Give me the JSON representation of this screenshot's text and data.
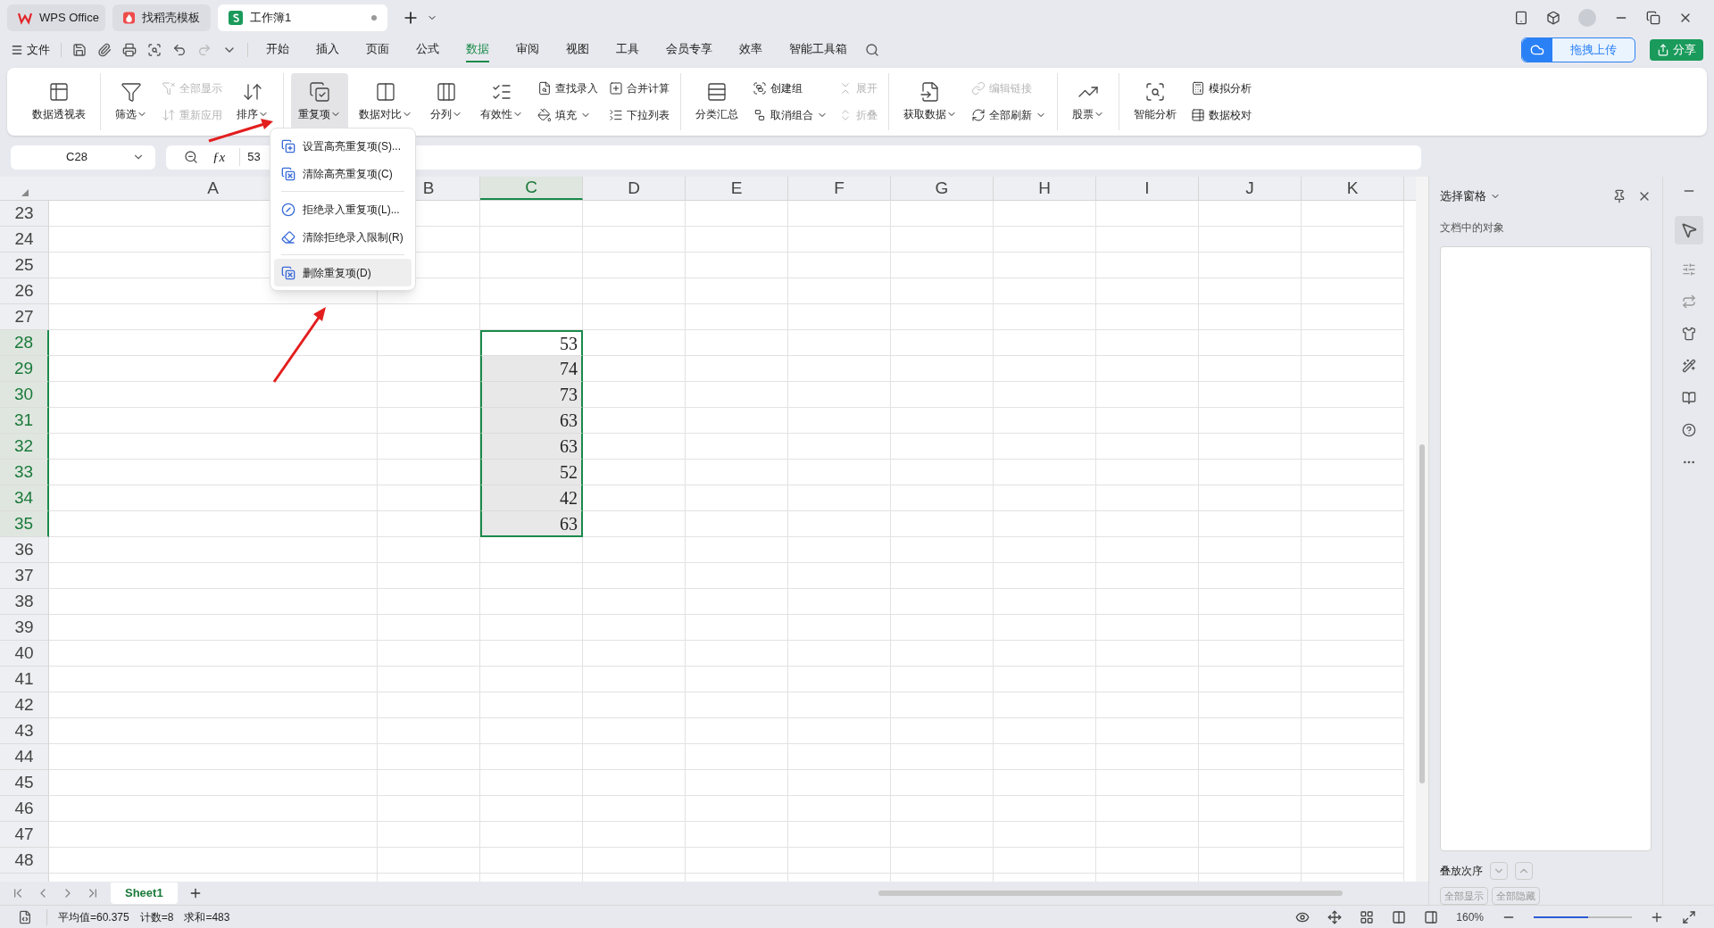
{
  "app_tabs": [
    {
      "label": "WPS Office",
      "kind": "home",
      "selected": false
    },
    {
      "label": "找稻壳模板",
      "kind": "template",
      "selected": false
    },
    {
      "label": "工作簿1",
      "kind": "sheet",
      "selected": true
    }
  ],
  "menu": {
    "file": "文件",
    "tabs": [
      {
        "label": "开始",
        "selected": false
      },
      {
        "label": "插入",
        "selected": false
      },
      {
        "label": "页面",
        "selected": false
      },
      {
        "label": "公式",
        "selected": false
      },
      {
        "label": "数据",
        "selected": true
      },
      {
        "label": "审阅",
        "selected": false
      },
      {
        "label": "视图",
        "selected": false
      },
      {
        "label": "工具",
        "selected": false
      },
      {
        "label": "会员专享",
        "selected": false
      },
      {
        "label": "效率",
        "selected": false
      },
      {
        "label": "智能工具箱",
        "selected": false
      }
    ],
    "upload": "拖拽上传",
    "share": "分享"
  },
  "ribbon": [
    {
      "items": [
        {
          "kind": "large",
          "label": "数据透视表",
          "dropdown": false,
          "pressed": false
        }
      ]
    },
    {
      "items": [
        {
          "kind": "large",
          "label": "筛选",
          "dropdown": true,
          "pressed": false
        },
        {
          "kind": "stack",
          "items": [
            {
              "label": "全部显示",
              "disabled": true,
              "dropdown": false
            },
            {
              "label": "重新应用",
              "disabled": true,
              "dropdown": false
            }
          ]
        },
        {
          "kind": "large",
          "label": "排序",
          "dropdown": true,
          "pressed": false
        }
      ]
    },
    {
      "items": [
        {
          "kind": "large",
          "label": "重复项",
          "dropdown": true,
          "pressed": true
        },
        {
          "kind": "large",
          "label": "数据对比",
          "dropdown": true,
          "pressed": false
        },
        {
          "kind": "large",
          "label": "分列",
          "dropdown": true,
          "pressed": false
        },
        {
          "kind": "large",
          "label": "有效性",
          "dropdown": true,
          "pressed": false
        },
        {
          "kind": "stack",
          "items": [
            {
              "label": "查找录入",
              "disabled": false,
              "dropdown": false
            },
            {
              "label": "填充",
              "disabled": false,
              "dropdown": true
            }
          ]
        },
        {
          "kind": "stack",
          "items": [
            {
              "label": "合并计算",
              "disabled": false,
              "dropdown": false
            },
            {
              "label": "下拉列表",
              "disabled": false,
              "dropdown": false
            }
          ]
        }
      ]
    },
    {
      "items": [
        {
          "kind": "large",
          "label": "分类汇总",
          "dropdown": false,
          "pressed": false
        },
        {
          "kind": "stack",
          "items": [
            {
              "label": "创建组",
              "disabled": false,
              "dropdown": false
            },
            {
              "label": "取消组合",
              "disabled": false,
              "dropdown": true
            }
          ]
        },
        {
          "kind": "stack",
          "items": [
            {
              "label": "展开",
              "disabled": true,
              "dropdown": false
            },
            {
              "label": "折叠",
              "disabled": true,
              "dropdown": false
            }
          ]
        }
      ]
    },
    {
      "items": [
        {
          "kind": "large",
          "label": "获取数据",
          "dropdown": true,
          "pressed": false
        },
        {
          "kind": "stack",
          "items": [
            {
              "label": "编辑链接",
              "disabled": true,
              "dropdown": false
            },
            {
              "label": "全部刷新",
              "disabled": false,
              "dropdown": true
            }
          ]
        }
      ]
    },
    {
      "items": [
        {
          "kind": "large",
          "label": "股票",
          "dropdown": true,
          "pressed": false
        }
      ]
    },
    {
      "items": [
        {
          "kind": "large",
          "label": "智能分析",
          "dropdown": false,
          "pressed": false
        },
        {
          "kind": "stack",
          "items": [
            {
              "label": "模拟分析",
              "disabled": false,
              "dropdown": false
            },
            {
              "label": "数据校对",
              "disabled": false,
              "dropdown": false
            }
          ]
        }
      ]
    }
  ],
  "name_box": "C28",
  "function_label": "ƒx",
  "formula": "53",
  "columns": [
    {
      "label": "A",
      "selected": false
    },
    {
      "label": "B",
      "selected": false
    },
    {
      "label": "C",
      "selected": true
    },
    {
      "label": "D",
      "selected": false
    },
    {
      "label": "E",
      "selected": false
    },
    {
      "label": "F",
      "selected": false
    },
    {
      "label": "G",
      "selected": false
    },
    {
      "label": "H",
      "selected": false
    },
    {
      "label": "I",
      "selected": false
    },
    {
      "label": "J",
      "selected": false
    },
    {
      "label": "K",
      "selected": false
    }
  ],
  "rows": [
    {
      "label": "23",
      "selected": false
    },
    {
      "label": "24",
      "selected": false
    },
    {
      "label": "25",
      "selected": false
    },
    {
      "label": "26",
      "selected": false
    },
    {
      "label": "27",
      "selected": false
    },
    {
      "label": "28",
      "selected": true,
      "active": true,
      "value": "53"
    },
    {
      "label": "29",
      "selected": true,
      "active": false,
      "value": "74"
    },
    {
      "label": "30",
      "selected": true,
      "active": false,
      "value": "73"
    },
    {
      "label": "31",
      "selected": true,
      "active": false,
      "value": "63"
    },
    {
      "label": "32",
      "selected": true,
      "active": false,
      "value": "63"
    },
    {
      "label": "33",
      "selected": true,
      "active": false,
      "value": "52"
    },
    {
      "label": "34",
      "selected": true,
      "active": false,
      "value": "42"
    },
    {
      "label": "35",
      "selected": true,
      "active": false,
      "value": "63"
    },
    {
      "label": "36",
      "selected": false
    },
    {
      "label": "37",
      "selected": false
    },
    {
      "label": "38",
      "selected": false
    },
    {
      "label": "39",
      "selected": false
    },
    {
      "label": "40",
      "selected": false
    },
    {
      "label": "41",
      "selected": false
    },
    {
      "label": "42",
      "selected": false
    },
    {
      "label": "43",
      "selected": false
    },
    {
      "label": "44",
      "selected": false
    },
    {
      "label": "45",
      "selected": false
    },
    {
      "label": "46",
      "selected": false
    },
    {
      "label": "47",
      "selected": false
    },
    {
      "label": "48",
      "selected": false
    }
  ],
  "dropdown": [
    {
      "kind": "item",
      "label": "设置高亮重复项(S)...",
      "highlighted": false
    },
    {
      "kind": "item",
      "label": "清除高亮重复项(C)",
      "highlighted": false
    },
    {
      "kind": "separator"
    },
    {
      "kind": "item",
      "label": "拒绝录入重复项(L)...",
      "highlighted": false
    },
    {
      "kind": "item",
      "label": "清除拒绝录入限制(R)",
      "highlighted": false
    },
    {
      "kind": "separator"
    },
    {
      "kind": "item",
      "label": "删除重复项(D)",
      "highlighted": true
    }
  ],
  "selection_pane": {
    "title": "选择窗格",
    "subtitle": "文档中的对象",
    "order_label": "叠放次序",
    "buttons": [
      "全部显示",
      "全部隐藏"
    ]
  },
  "sheet_tabs": [
    {
      "label": "Sheet1",
      "selected": true
    }
  ],
  "status": {
    "stats": [
      "平均值=60.375",
      "计数=8",
      "求和=483"
    ],
    "zoom": "160%",
    "zoom_slider": {
      "level": 0.55
    }
  }
}
